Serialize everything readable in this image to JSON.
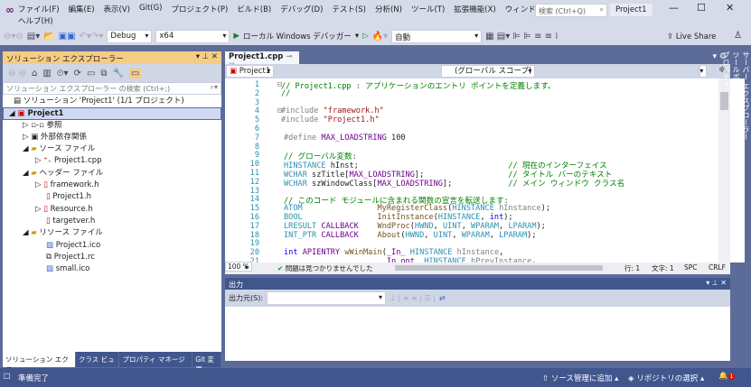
{
  "menu": [
    "ファイル(F)",
    "編集(E)",
    "表示(V)",
    "Git(G)",
    "プロジェクト(P)",
    "ビルド(B)",
    "デバッグ(D)",
    "テスト(S)",
    "分析(N)",
    "ツール(T)",
    "拡張機能(X)",
    "ウィンドウ(W)",
    "ヘルプ(H)"
  ],
  "search_placeholder": "検索 (Ctrl+Q)",
  "window_title": "Project1",
  "toolbar": {
    "config": "Debug",
    "platform": "x64",
    "run": "ローカル Windows デバッガー",
    "start_mode": "自動",
    "live_share": "Live Share"
  },
  "solution_explorer": {
    "title": "ソリューション エクスプローラー",
    "search": "ソリューション エクスプローラー の検索 (Ctrl+;)",
    "items": [
      {
        "label": "ソリューション 'Project1' (1/1 プロジェクト)",
        "icon": "solution-icon"
      },
      {
        "label": "Project1",
        "icon": "project-icon"
      },
      {
        "label": "参照",
        "icon": "references-icon"
      },
      {
        "label": "外部依存関係",
        "icon": "external-deps-icon"
      },
      {
        "label": "ソース ファイル",
        "icon": "folder-icon"
      },
      {
        "label": "Project1.cpp",
        "icon": "cpp-file-icon"
      },
      {
        "label": "ヘッダー ファイル",
        "icon": "folder-icon"
      },
      {
        "label": "framework.h",
        "icon": "header-file-icon"
      },
      {
        "label": "Project1.h",
        "icon": "header-file-icon"
      },
      {
        "label": "Resource.h",
        "icon": "header-file-icon"
      },
      {
        "label": "targetver.h",
        "icon": "header-file-icon"
      },
      {
        "label": "リソース ファイル",
        "icon": "folder-icon"
      },
      {
        "label": "Project1.ico",
        "icon": "image-file-icon"
      },
      {
        "label": "Project1.rc",
        "icon": "rc-file-icon"
      },
      {
        "label": "small.ico",
        "icon": "image-file-icon"
      }
    ],
    "tabs": [
      "ソリューション エクス...",
      "クラス ビュー",
      "プロパティ マネージャー",
      "Git 変更"
    ]
  },
  "editor": {
    "tab": "Project1.cpp",
    "nav_project": "Project1",
    "nav_scope": "(グローバル スコープ)",
    "zoom": "100 %",
    "issues": "問題は見つかりませんでした",
    "line": "行: 1",
    "col": "文字: 1",
    "spc": "SPC",
    "crlf": "CRLF"
  },
  "output": {
    "title": "出力",
    "source_label": "出力元(S):"
  },
  "side_tabs": [
    "サーバー エクスプローラー",
    "ツールボックス",
    "プロパティ"
  ],
  "status": {
    "ready": "準備完了",
    "source_control": "ソース管理に追加",
    "repo": "リポジトリの選択",
    "notifications": "1"
  }
}
